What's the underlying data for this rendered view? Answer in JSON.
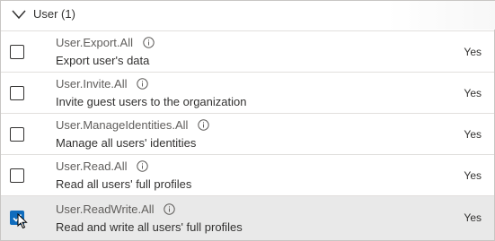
{
  "group": {
    "title": "User (1)"
  },
  "permissions": [
    {
      "name": "User.Export.All",
      "description": "Export user's data",
      "status": "Yes",
      "checked": false
    },
    {
      "name": "User.Invite.All",
      "description": "Invite guest users to the organization",
      "status": "Yes",
      "checked": false
    },
    {
      "name": "User.ManageIdentities.All",
      "description": "Manage all users' identities",
      "status": "Yes",
      "checked": false
    },
    {
      "name": "User.Read.All",
      "description": "Read all users' full profiles",
      "status": "Yes",
      "checked": false
    },
    {
      "name": "User.ReadWrite.All",
      "description": "Read and write all users' full profiles",
      "status": "Yes",
      "checked": true
    }
  ],
  "icons": {
    "expand": "chevron-down-icon",
    "info": "info-icon",
    "check": "checkmark-icon",
    "pointer": "mouse-pointer-icon"
  },
  "colors": {
    "checkbox_checked": "#0f6cbd",
    "selected_row": "#e9e9e9"
  }
}
